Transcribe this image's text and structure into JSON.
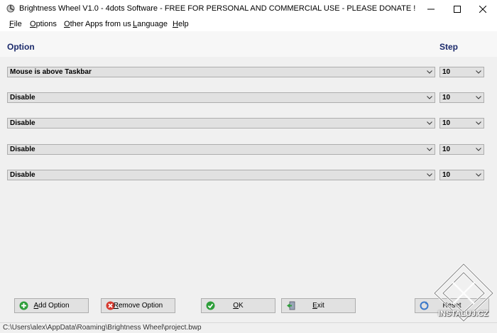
{
  "window": {
    "title": "Brightness Wheel V1.0 - 4dots Software - FREE FOR PERSONAL AND COMMERCIAL USE - PLEASE DONATE !"
  },
  "menu": [
    {
      "first": "F",
      "rest": "ile"
    },
    {
      "first": "O",
      "rest": "ptions"
    },
    {
      "first": "O",
      "rest": "ther Apps from us"
    },
    {
      "first": "L",
      "rest": "anguage"
    },
    {
      "first": "H",
      "rest": "elp"
    }
  ],
  "header": {
    "option": "Option",
    "step": "Step"
  },
  "rows": [
    {
      "option": "Mouse is above Taskbar",
      "step": "10"
    },
    {
      "option": "Disable",
      "step": "10"
    },
    {
      "option": "Disable",
      "step": "10"
    },
    {
      "option": "Disable",
      "step": "10"
    },
    {
      "option": "Disable",
      "step": "10"
    }
  ],
  "buttons": {
    "add_first": "A",
    "add_rest": "dd Option",
    "remove_first": "R",
    "remove_rest": "emove Option",
    "ok_first": "O",
    "ok_rest": "K",
    "exit_first": "E",
    "exit_rest": "xit",
    "reset": "Reset"
  },
  "icons": {
    "app": "wheel-icon",
    "add": "add-icon",
    "remove": "remove-icon",
    "ok": "check-icon",
    "exit": "exit-icon",
    "reset": "reset-icon"
  },
  "status": {
    "path": "C:\\Users\\alex\\AppData\\Roaming\\Brightness Wheel\\project.bwp"
  },
  "watermark": {
    "text": "INSTALUJ.CZ"
  },
  "colors": {
    "header_text": "#1b2a6b",
    "add": "#2e9e3a",
    "remove": "#d63a2f",
    "ok": "#2e9e3a"
  }
}
